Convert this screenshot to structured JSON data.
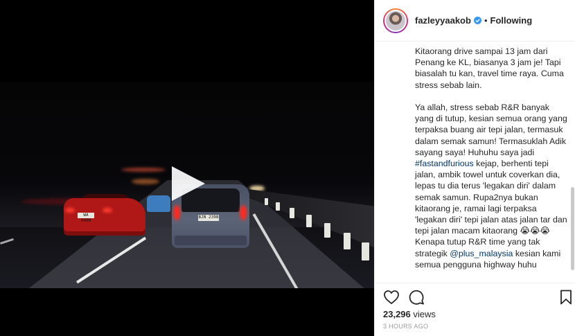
{
  "post": {
    "username": "fazleyyaakob",
    "verified": true,
    "separator": "•",
    "follow_state": "Following"
  },
  "video": {
    "plate_red": "WA 0000",
    "plate_suv": "BJN 2398"
  },
  "caption": {
    "paragraph_1": "Kitaorang drive sampai 13 jam dari Penang ke KL, biasanya 3 jam je! Tapi biasalah tu kan, travel time raya. Cuma stress sebab lain.",
    "paragraph_2_a": "Ya allah, stress sebab R&R banyak yang di tutup, kesian semua orang yang terpaksa buang air tepi jalan, termasuk dalam semak samun! Termasuklah Adik sayang saya! Huhuhu saya jadi ",
    "hashtag": "#fastandfurious",
    "paragraph_2_b": " kejap, berhenti tepi jalan, ambik towel untuk coverkan dia, lepas tu dia terus 'legakan diri' dalam semak samun. Rupa2nya bukan kitaorang je, ramai lagi terpaksa 'legakan diri' tepi jalan atas jalan tar dan tepi jalan macam kitaorang 😭😭😭 Kenapa tutup R&R time yang tak strategik ",
    "mention": "@plus_malaysia",
    "paragraph_2_c": " kesian kami semua pengguna highway huhu"
  },
  "stats": {
    "views_count": "23,296",
    "views_label": "views",
    "time_ago": "3 HOURS AGO"
  },
  "icons": {
    "like": "heart-icon",
    "comment": "comment-icon",
    "save": "bookmark-icon",
    "play": "play-icon",
    "verified": "verified-badge-icon"
  },
  "colors": {
    "link": "#003569",
    "verified_badge": "#3897f0",
    "text": "#262626",
    "muted": "#999999"
  }
}
